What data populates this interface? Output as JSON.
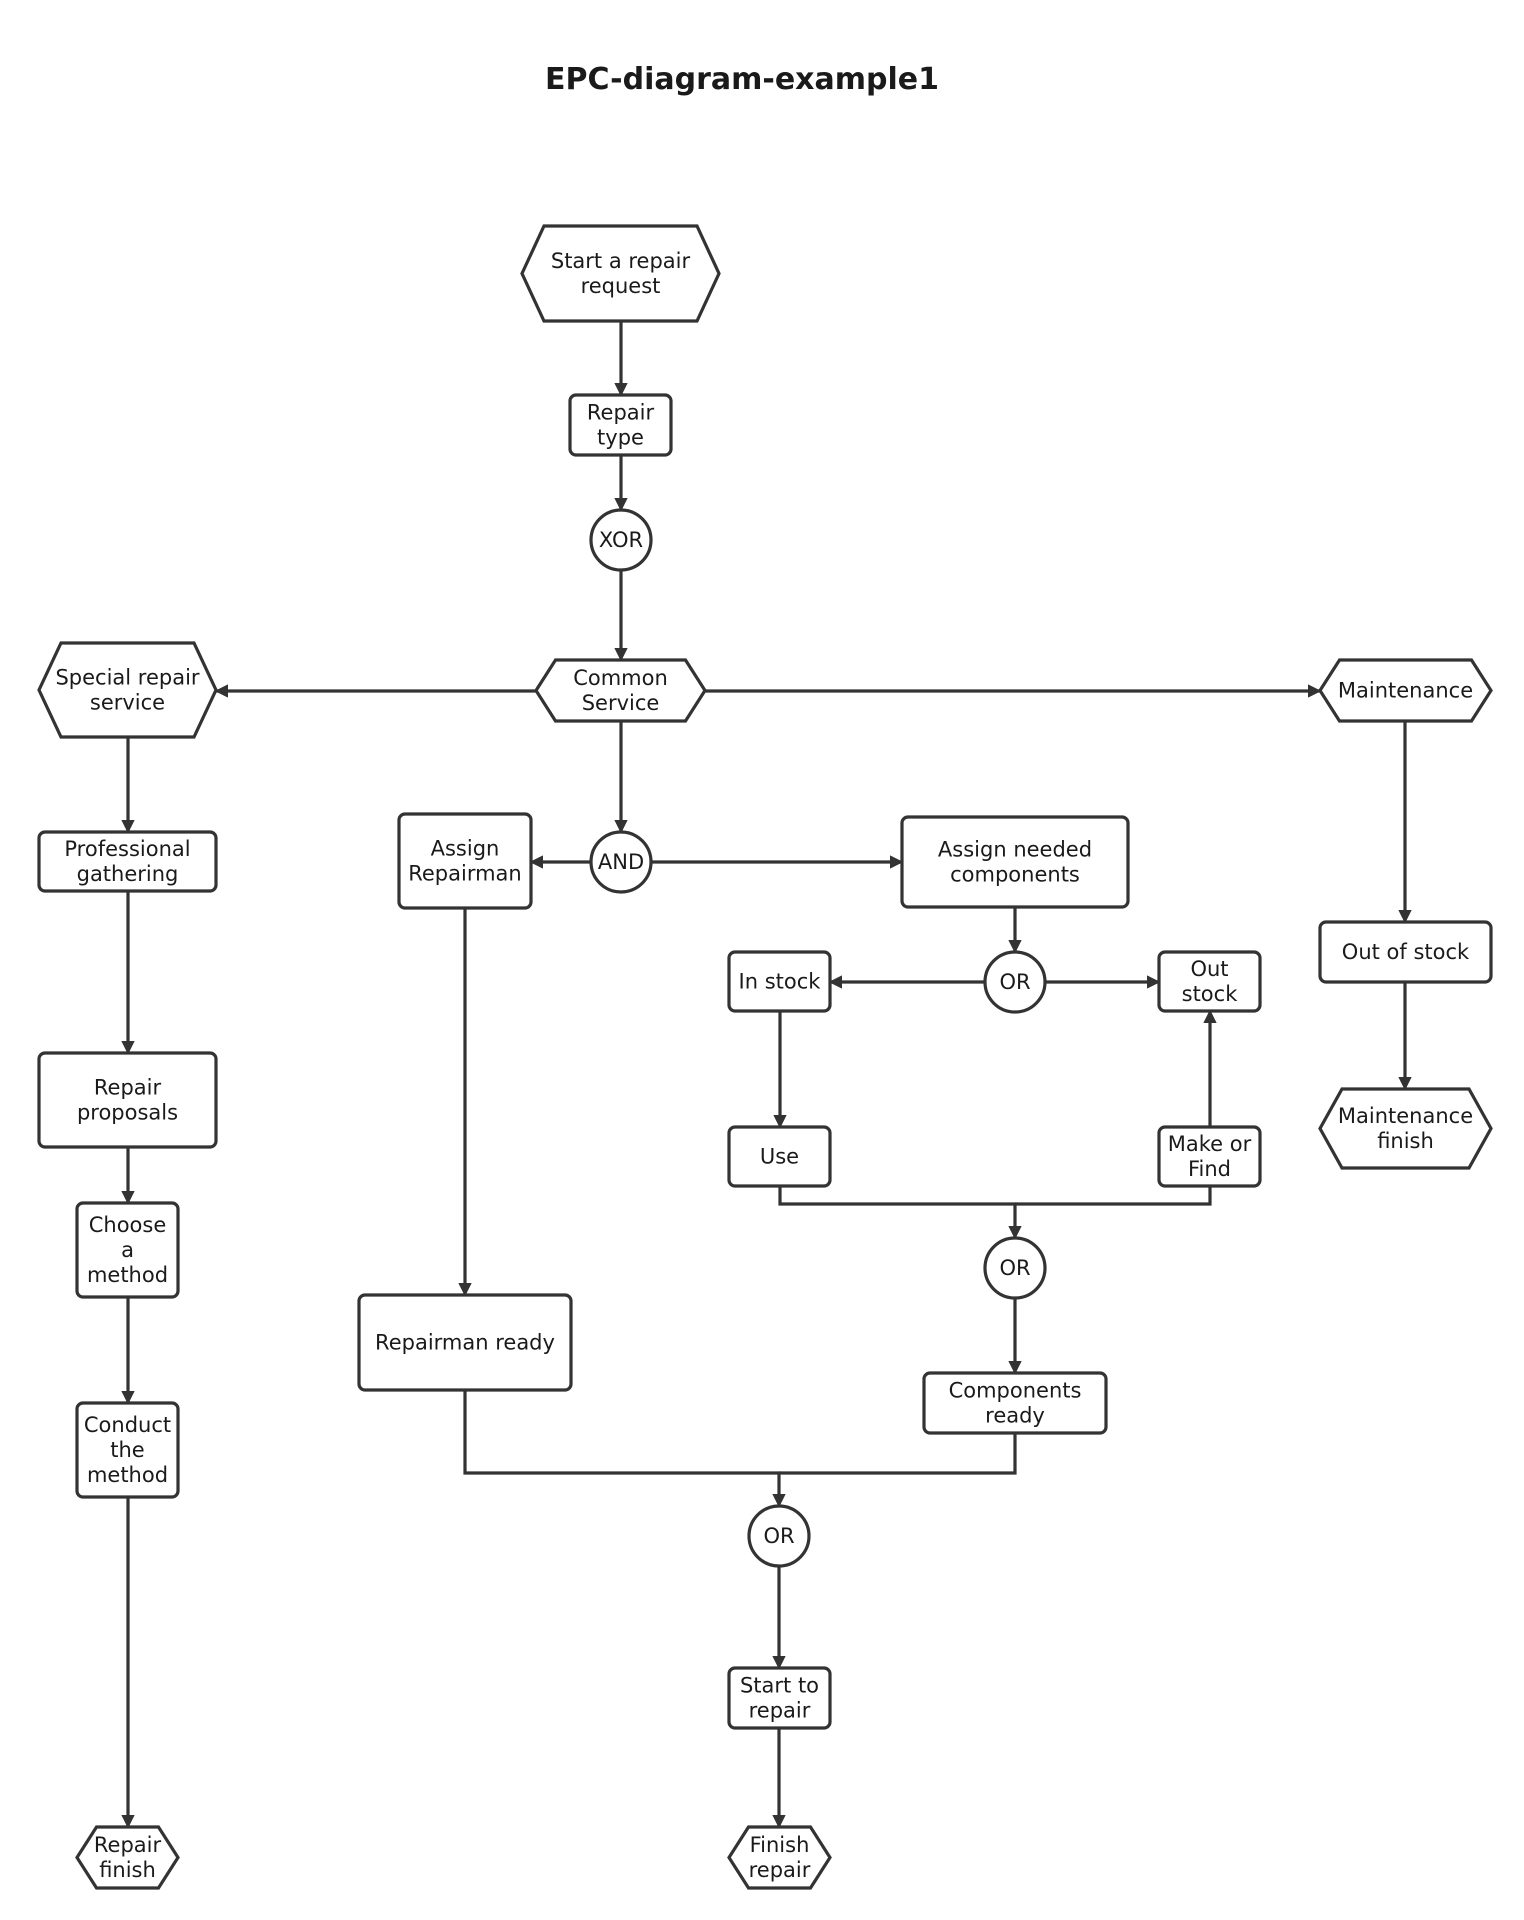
{
  "title": "EPC-diagram-example1",
  "colors": {
    "stroke": "#333333",
    "text": "#1a1a1a",
    "background": "#ffffff"
  },
  "nodes": {
    "start_repair_request": {
      "type": "event",
      "lines": [
        "Start a repair",
        "request"
      ]
    },
    "repair_type": {
      "type": "function",
      "lines": [
        "Repair",
        "type"
      ]
    },
    "xor": {
      "type": "connector",
      "lines": [
        "XOR"
      ]
    },
    "common_service": {
      "type": "event",
      "lines": [
        "Common",
        "Service"
      ]
    },
    "special_repair_service": {
      "type": "event",
      "lines": [
        "Special repair",
        "service"
      ]
    },
    "maintenance": {
      "type": "event",
      "lines": [
        "Maintenance"
      ]
    },
    "and": {
      "type": "connector",
      "lines": [
        "AND"
      ]
    },
    "assign_repairman": {
      "type": "function",
      "lines": [
        "Assign",
        "Repairman"
      ]
    },
    "assign_needed_components": {
      "type": "function",
      "lines": [
        "Assign needed",
        "components"
      ]
    },
    "professional_gathering": {
      "type": "function",
      "lines": [
        "Professional",
        "gathering"
      ]
    },
    "repair_proposals": {
      "type": "function",
      "lines": [
        "Repair",
        "proposals"
      ]
    },
    "choose_a_method": {
      "type": "function",
      "lines": [
        "Choose",
        "a",
        "method"
      ]
    },
    "conduct_the_method": {
      "type": "function",
      "lines": [
        "Conduct",
        "the",
        "method"
      ]
    },
    "repair_finish": {
      "type": "event",
      "lines": [
        "Repair",
        "finish"
      ]
    },
    "or_stock": {
      "type": "connector",
      "lines": [
        "OR"
      ]
    },
    "in_stock": {
      "type": "function",
      "lines": [
        "In stock"
      ]
    },
    "out_stock": {
      "type": "function",
      "lines": [
        "Out",
        "stock"
      ]
    },
    "use": {
      "type": "function",
      "lines": [
        "Use"
      ]
    },
    "make_or_find": {
      "type": "function",
      "lines": [
        "Make or",
        "Find"
      ]
    },
    "or_components": {
      "type": "connector",
      "lines": [
        "OR"
      ]
    },
    "components_ready": {
      "type": "function",
      "lines": [
        "Components",
        "ready"
      ]
    },
    "repairman_ready": {
      "type": "function",
      "lines": [
        "Repairman ready"
      ]
    },
    "or_final": {
      "type": "connector",
      "lines": [
        "OR"
      ]
    },
    "start_to_repair": {
      "type": "function",
      "lines": [
        "Start to",
        "repair"
      ]
    },
    "finish_repair": {
      "type": "event",
      "lines": [
        "Finish",
        "repair"
      ]
    },
    "out_of_stock": {
      "type": "function",
      "lines": [
        "Out of stock"
      ]
    },
    "maintenance_finish": {
      "type": "event",
      "lines": [
        "Maintenance",
        "finish"
      ]
    }
  },
  "edges": [
    [
      "start_repair_request",
      "repair_type"
    ],
    [
      "repair_type",
      "xor"
    ],
    [
      "xor",
      "common_service"
    ],
    [
      "common_service",
      "special_repair_service"
    ],
    [
      "common_service",
      "maintenance"
    ],
    [
      "common_service",
      "and"
    ],
    [
      "and",
      "assign_repairman"
    ],
    [
      "and",
      "assign_needed_components"
    ],
    [
      "special_repair_service",
      "professional_gathering"
    ],
    [
      "professional_gathering",
      "repair_proposals"
    ],
    [
      "repair_proposals",
      "choose_a_method"
    ],
    [
      "choose_a_method",
      "conduct_the_method"
    ],
    [
      "conduct_the_method",
      "repair_finish"
    ],
    [
      "assign_needed_components",
      "or_stock"
    ],
    [
      "or_stock",
      "in_stock"
    ],
    [
      "or_stock",
      "out_stock"
    ],
    [
      "in_stock",
      "use"
    ],
    [
      "make_or_find",
      "out_stock"
    ],
    [
      "use",
      "or_components"
    ],
    [
      "make_or_find",
      "or_components"
    ],
    [
      "or_components",
      "components_ready"
    ],
    [
      "assign_repairman",
      "repairman_ready"
    ],
    [
      "repairman_ready",
      "or_final"
    ],
    [
      "components_ready",
      "or_final"
    ],
    [
      "or_final",
      "start_to_repair"
    ],
    [
      "start_to_repair",
      "finish_repair"
    ],
    [
      "maintenance",
      "out_of_stock"
    ],
    [
      "out_of_stock",
      "maintenance_finish"
    ]
  ]
}
